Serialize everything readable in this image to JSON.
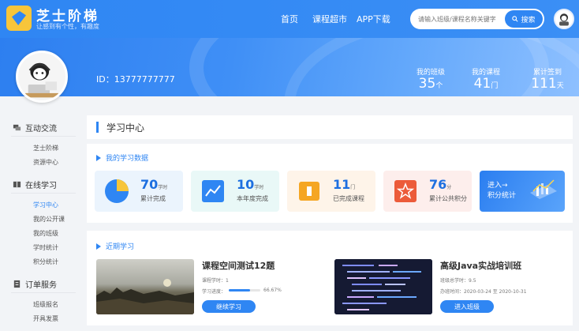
{
  "brand": {
    "title": "芝士阶梯",
    "tagline": "让感到有个性，有趣度"
  },
  "nav": [
    "首页",
    "课程超市",
    "APP下载"
  ],
  "search": {
    "placeholder": "请输入班级/课程名称关键字",
    "button": "搜索"
  },
  "profile": {
    "id_text": "ID：13777777777"
  },
  "stats": [
    {
      "label": "我的班级",
      "value": "35",
      "unit": "个"
    },
    {
      "label": "我的课程",
      "value": "41",
      "unit": "门"
    },
    {
      "label": "累计签到",
      "value": "111",
      "unit": "天"
    }
  ],
  "sidebar": {
    "groups": [
      {
        "title": "互动交流",
        "items": [
          "芝士阶梯",
          "资源中心"
        ]
      },
      {
        "title": "在线学习",
        "items": [
          "学习中心",
          "我的公开课",
          "我的班级",
          "学时统计",
          "积分统计"
        ]
      },
      {
        "title": "订单服务",
        "items": [
          "班级报名",
          "开具发票"
        ]
      }
    ]
  },
  "main": {
    "title": "学习中心",
    "data_section": "我的学习数据",
    "cards": [
      {
        "value": "70",
        "unit": "学时",
        "caption": "累计完成",
        "icon": "pie-chart-icon"
      },
      {
        "value": "10",
        "unit": "学时",
        "caption": "本年度完成",
        "icon": "line-chart-icon"
      },
      {
        "value": "11",
        "unit": "门",
        "caption": "已完成课程",
        "icon": "book-icon"
      },
      {
        "value": "76",
        "unit": "分",
        "caption": "累计公共积分",
        "icon": "star-icon"
      }
    ],
    "enter_card": {
      "line1": "进入→",
      "line2": "积分统计"
    },
    "recent_section": "近期学习",
    "courses": [
      {
        "title": "课程空间测试12题",
        "meta1": "课程学时：1",
        "progress_label": "学习进度：",
        "progress_value": "66.67%",
        "progress_fraction": 0.6667,
        "button": "继续学习"
      },
      {
        "title": "高级Java实战培训班",
        "meta1": "班级总学时：9.5",
        "meta2": "办班时间：2020-03-24 至 2020-10-31",
        "button": "进入班级"
      }
    ]
  },
  "colors": {
    "primary": "#2f86f3",
    "logo": "#f7c53a"
  }
}
